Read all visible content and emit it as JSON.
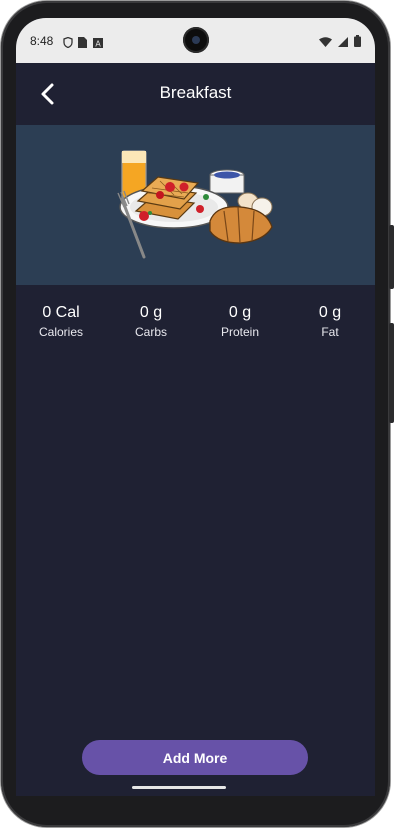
{
  "status_bar": {
    "time": "8:48",
    "icons_left": [
      "shield-icon",
      "sim-icon",
      "font-icon"
    ],
    "icons_right": [
      "wifi-icon",
      "signal-icon",
      "battery-icon"
    ]
  },
  "header": {
    "title": "Breakfast",
    "back_icon": "chevron-left-icon"
  },
  "hero": {
    "image": "breakfast-plate-illustration"
  },
  "stats": [
    {
      "value": "0 Cal",
      "label": "Calories"
    },
    {
      "value": "0 g",
      "label": "Carbs"
    },
    {
      "value": "0 g",
      "label": "Protein"
    },
    {
      "value": "0 g",
      "label": "Fat"
    }
  ],
  "actions": {
    "add_more": "Add More"
  },
  "colors": {
    "background": "#1f2133",
    "hero_bg": "#2c3e54",
    "accent": "#6752a8",
    "text": "#ffffff"
  }
}
